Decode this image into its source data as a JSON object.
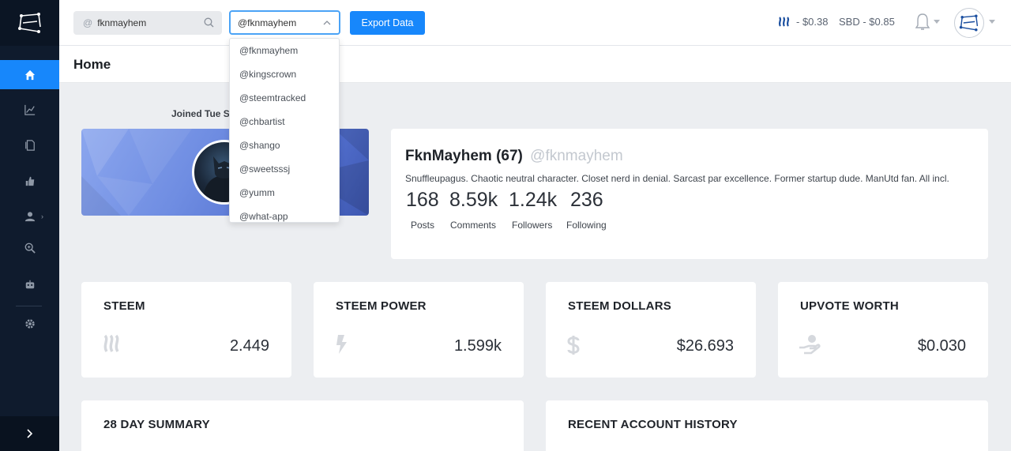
{
  "header": {
    "search_at": "@",
    "search_value": "fknmayhem",
    "account_select": "@fknmayhem",
    "export_label": "Export Data",
    "steem_price": "- $0.38",
    "sbd_price": "SBD - $0.85"
  },
  "page": {
    "title": "Home"
  },
  "account_dropdown": {
    "options": [
      "@fknmayhem",
      "@kingscrown",
      "@steemtracked",
      "@chbartist",
      "@shango",
      "@sweetsssj",
      "@yumm",
      "@what-app"
    ]
  },
  "profile": {
    "joined": "Joined Tue Se",
    "name": "FknMayhem",
    "reputation": "(67)",
    "handle": "@fknmayhem",
    "bio": "Snuffleupagus. Chaotic neutral character. Closet nerd in denial. Sarcast par excellence. Former startup dude. ManUtd fan. All incl.",
    "stats": [
      {
        "value": "168",
        "label": "Posts"
      },
      {
        "value": "8.59k",
        "label": "Comments"
      },
      {
        "value": "1.24k",
        "label": "Followers"
      },
      {
        "value": "236",
        "label": "Following"
      }
    ]
  },
  "wallet_cards": [
    {
      "title": "STEEM",
      "value": "2.449",
      "icon": "steem-icon"
    },
    {
      "title": "STEEM POWER",
      "value": "1.599k",
      "icon": "lightning-icon"
    },
    {
      "title": "STEEM DOLLARS",
      "value": "$26.693",
      "icon": "dollar-icon"
    },
    {
      "title": "UPVOTE WORTH",
      "value": "$0.030",
      "icon": "hand-coin-icon"
    }
  ],
  "sections": {
    "summary_title": "28 DAY SUMMARY",
    "history_title": "RECENT ACCOUNT HISTORY"
  },
  "colors": {
    "accent": "#1787fb",
    "sidebar": "#0f1b2d"
  }
}
